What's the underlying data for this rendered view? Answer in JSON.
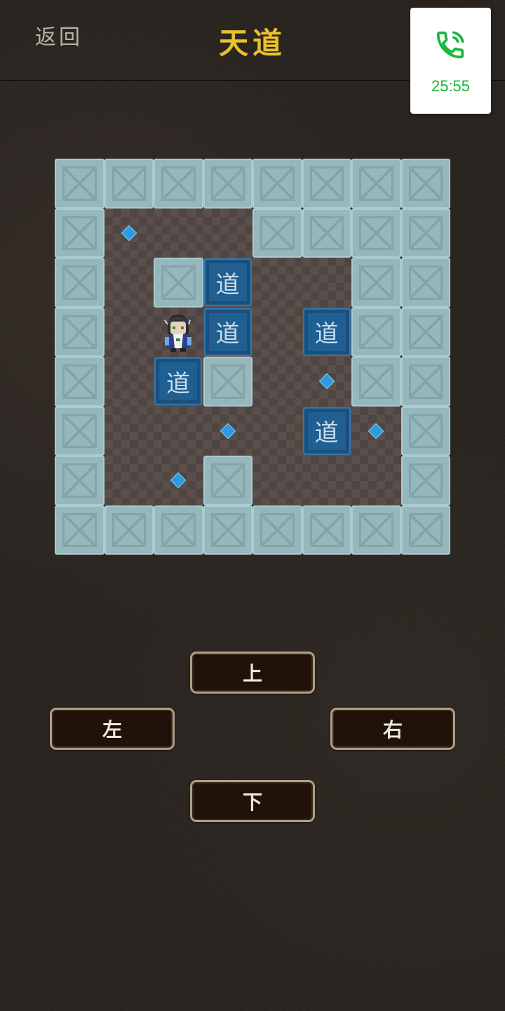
{
  "header": {
    "back_label": "返回",
    "title": "天道",
    "title_color": "#e8c22c"
  },
  "call": {
    "icon": "phone-icon",
    "time": "25:55",
    "color": "#19b53a"
  },
  "board": {
    "rows": [
      "########",
      "#.  ####",
      "# #B  ##",
      "# PB B##",
      "# B# .##",
      "#  . B.#",
      "# .#   #",
      "########"
    ],
    "legend": {
      "#": "wall",
      " ": "floor",
      ".": "target",
      "B": "box",
      "P": "player"
    },
    "box_label": "道",
    "colors": {
      "wall": "#96b8bd",
      "floor": "#5a4f4b",
      "box": "#1f5f92",
      "target": "#2e9be0"
    }
  },
  "controls": {
    "up": "上",
    "left": "左",
    "right": "右",
    "down": "下"
  }
}
